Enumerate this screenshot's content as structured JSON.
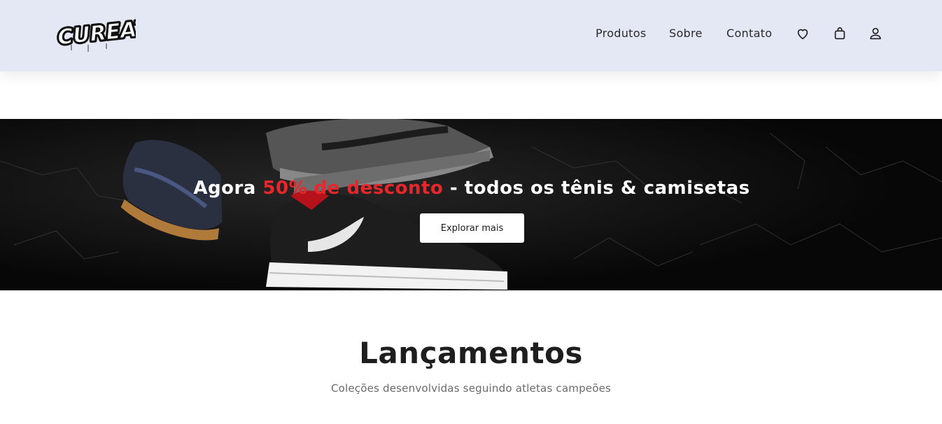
{
  "header": {
    "logo_text": "CUREATE",
    "nav": {
      "produtos": "Produtos",
      "sobre": "Sobre",
      "contato": "Contato"
    },
    "icons": [
      "heart-icon",
      "shopping-bag-icon",
      "user-icon"
    ]
  },
  "banner": {
    "title_prefix": "Agora ",
    "title_accent": "50% de desconto",
    "title_suffix": " - todos os tênis & camisetas",
    "button_label": "Explorar mais",
    "accent_color": "#e8262b"
  },
  "section": {
    "title": "Lançamentos",
    "subtitle": "Coleções desenvolvidas seguindo atletas campeões"
  }
}
